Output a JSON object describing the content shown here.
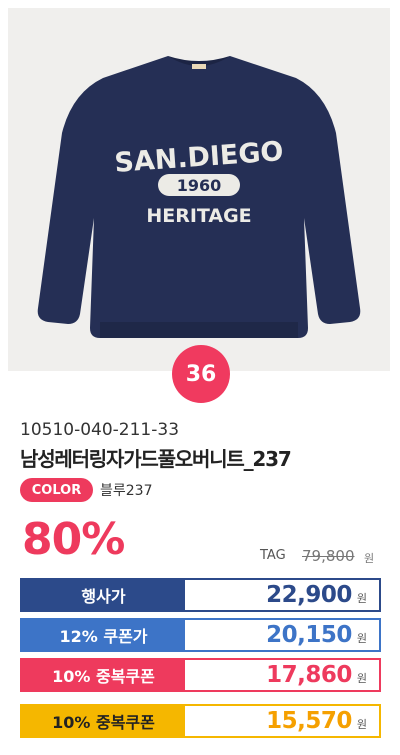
{
  "product": {
    "rank": "36",
    "code": "10510-040-211-33",
    "name": "남성레터링자가드풀오버니트_237",
    "color_label": "COLOR",
    "color_value": "블루237",
    "image_text": {
      "line1": "SAN.DIEGO",
      "line2": "1960",
      "line3": "HERITAGE"
    }
  },
  "pricing": {
    "discount": "80%",
    "tag_label": "TAG",
    "tag_price": "79,800",
    "tag_unit": "원",
    "rows": [
      {
        "label": "행사가",
        "price": "22,900",
        "unit": "원"
      },
      {
        "label": "12% 쿠폰가",
        "price": "20,150",
        "unit": "원"
      },
      {
        "label": "10% 중복쿠폰",
        "price": "17,860",
        "unit": "원"
      },
      {
        "label": "10% 중복쿠폰",
        "price": "15,570",
        "unit": "원"
      }
    ]
  },
  "colors": {
    "navy": "#2c4a8a",
    "blue": "#3d74c7",
    "pink": "#ee3a5d",
    "yellow": "#f5b700",
    "sweater": "#252f55"
  }
}
